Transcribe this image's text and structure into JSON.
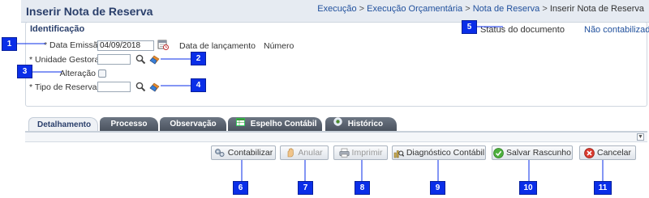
{
  "page": {
    "title": "Inserir Nota de Reserva",
    "breadcrumb": [
      {
        "label": "Execução",
        "link": true
      },
      {
        "label": "Execução Orçamentária",
        "link": true
      },
      {
        "label": "Nota de Reserva",
        "link": true
      },
      {
        "label": "Inserir Nota de Reserva",
        "link": false
      }
    ],
    "breadcrumb_separator": ">"
  },
  "identificacao": {
    "title": "Identificação",
    "status_label": "Status do documento",
    "status_value": "Não contabilizado",
    "data_emissao_label": "Data Emissão",
    "data_emissao_value": "04/09/2018",
    "data_lancamento_label": "Data de lançamento",
    "numero_label": "Número",
    "unidade_gestora_label": "Unidade Gestora",
    "unidade_gestora_value": "",
    "alteracao_label": "Alteração",
    "tipo_reserva_label": "Tipo de Reserva",
    "tipo_reserva_value": "",
    "required_mark": "*"
  },
  "tabs": [
    {
      "label": "Detalhamento",
      "active": true
    },
    {
      "label": "Processo",
      "active": false
    },
    {
      "label": "Observação",
      "active": false
    },
    {
      "label": "Espelho Contábil",
      "active": false,
      "icon": "table-icon"
    },
    {
      "label": "Histórico",
      "active": false,
      "icon": "history-icon"
    }
  ],
  "scroll_arrow": "▼",
  "buttons": {
    "contabilizar": {
      "label": "Contabilizar",
      "icon": "gears-icon",
      "enabled": true
    },
    "anular": {
      "label": "Anular",
      "icon": "hand-icon",
      "enabled": false
    },
    "imprimir": {
      "label": "Imprimir",
      "icon": "printer-icon",
      "enabled": false
    },
    "diagnostico": {
      "label": "Diagnóstico Contábil",
      "icon": "diagnostic-icon",
      "enabled": true
    },
    "salvar_rascunho": {
      "label": "Salvar Rascunho",
      "icon": "check-icon",
      "enabled": true
    },
    "cancelar": {
      "label": "Cancelar",
      "icon": "cancel-icon",
      "enabled": true
    }
  },
  "callouts": [
    "1",
    "2",
    "3",
    "4",
    "5",
    "6",
    "7",
    "8",
    "9",
    "10",
    "11"
  ],
  "colors": {
    "callout": "#0a2ee8",
    "title": "#2a3f6b",
    "link": "#1f4f9c",
    "tab_dark": "#4b535f"
  }
}
